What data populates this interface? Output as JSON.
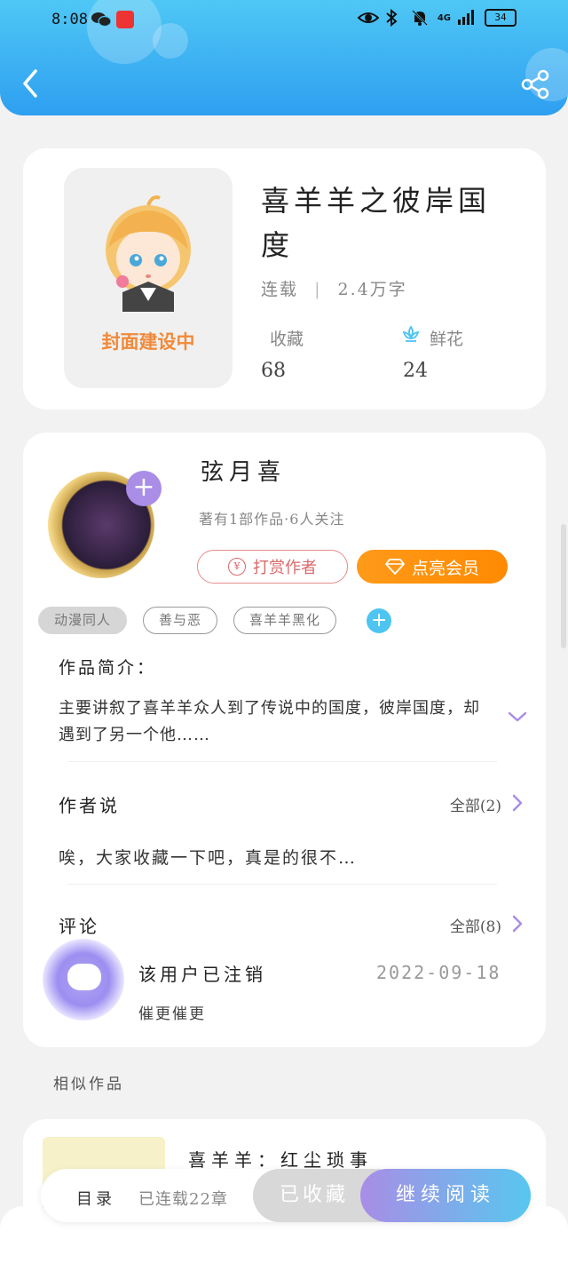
{
  "status_bar": {
    "time": "8:08",
    "network": "4G",
    "battery": "34"
  },
  "book": {
    "title": "喜羊羊之彼岸国度",
    "status": "连载",
    "word_count": "2.4万字",
    "cover_label": "封面建设中",
    "favorites_label": "收藏",
    "favorites_count": "68",
    "flowers_label": "鲜花",
    "flowers_count": "24"
  },
  "author": {
    "name": "弦月喜",
    "stats": "著有1部作品·6人关注",
    "tip_button": "打赏作者",
    "tip_coin": "¥",
    "vip_button": "点亮会员",
    "tags": [
      "动漫同人",
      "善与恶",
      "喜羊羊黑化"
    ],
    "tag_add": "+",
    "follow": "+"
  },
  "intro": {
    "title": "作品简介：",
    "text": "主要讲叙了喜羊羊众人到了传说中的国度，彼岸国度，却遇到了另一个他……"
  },
  "author_says": {
    "title": "作者说",
    "all_link": "全部(2)",
    "text": "唉，大家收藏一下吧，真是的很不…"
  },
  "comments": {
    "title": "评论",
    "all_link": "全部(8)",
    "items": [
      {
        "user": "该用户已注销",
        "text": "催更催更",
        "date": "2022-09-18"
      }
    ]
  },
  "similar": {
    "title": "相似作品",
    "items": [
      {
        "title": "喜羊羊：红尘琐事"
      }
    ]
  },
  "bottom_bar": {
    "catalog": "目录",
    "catalog_sub": "已连载22章",
    "collected": "已收藏",
    "continue_read": "继续阅读"
  },
  "colors": {
    "header_top": "#4fc7f5",
    "header_bottom": "#2e9ff0",
    "vip_orange": "#ff8a00",
    "tip_red": "#d96a6a",
    "accent_purple": "#a98de6",
    "accent_blue": "#4ec5f1"
  }
}
